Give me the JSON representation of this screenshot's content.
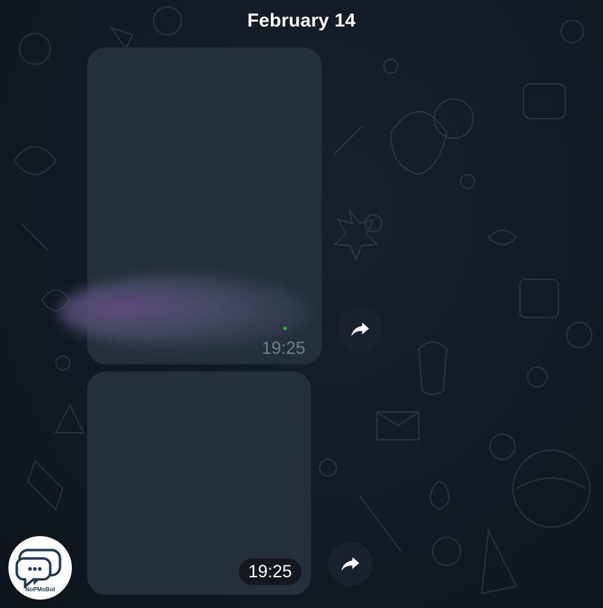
{
  "chat": {
    "date_label": "February 14",
    "messages": [
      {
        "time": "19:25",
        "media": "image-preview-blurred"
      },
      {
        "time": "19:25",
        "media": "image-preview-empty"
      }
    ],
    "share_icon": "share-arrow-icon"
  },
  "bot": {
    "avatar_label": "NoPMsBot",
    "logo_icon": "chat-bubbles-icon"
  },
  "colors": {
    "background": "#0e1621",
    "bubble": "#232f3a",
    "time_pill": "#15191f",
    "share_button": "#18222d"
  }
}
